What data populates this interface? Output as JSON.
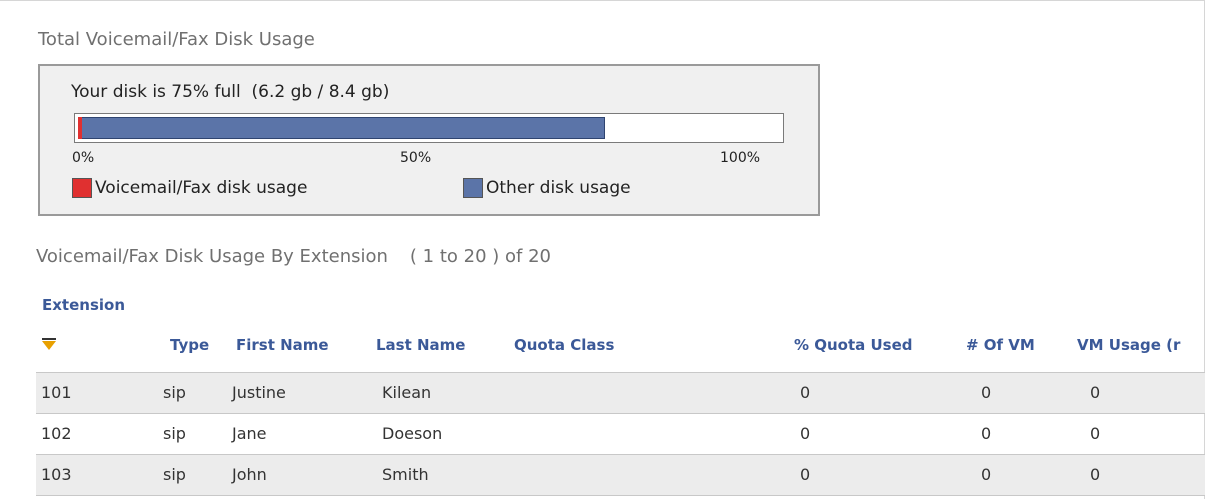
{
  "disk_usage": {
    "title": "Total Voicemail/Fax Disk Usage",
    "summary": "Your disk is 75% full  (6.2 gb / 8.4 gb)",
    "percent_full": 75,
    "voicemail_percent": 1,
    "ticks": [
      "0%",
      "50%",
      "100%"
    ],
    "legend": [
      {
        "label": "Voicemail/Fax disk usage",
        "color": "#e03030"
      },
      {
        "label": "Other disk usage",
        "color": "#5b74a8"
      }
    ]
  },
  "extensions": {
    "title": "Voicemail/Fax Disk Usage By Extension",
    "range": "( 1 to 20 ) of 20",
    "columns": {
      "extension": "Extension",
      "type": "Type",
      "first_name": "First Name",
      "last_name": "Last Name",
      "quota_class": "Quota Class",
      "quota_used": "% Quota Used",
      "vm_count": "# Of VM",
      "vm_usage": "VM Usage (r"
    },
    "sort_icon": "sort-descending-icon",
    "rows": [
      {
        "extension": "101",
        "type": "sip",
        "first_name": "Justine",
        "last_name": "Kilean",
        "quota_class": "",
        "quota_used": "0",
        "vm_count": "0",
        "vm_usage": "0"
      },
      {
        "extension": "102",
        "type": "sip",
        "first_name": "Jane",
        "last_name": "Doeson",
        "quota_class": "",
        "quota_used": "0",
        "vm_count": "0",
        "vm_usage": "0"
      },
      {
        "extension": "103",
        "type": "sip",
        "first_name": "John",
        "last_name": "Smith",
        "quota_class": "",
        "quota_used": "0",
        "vm_count": "0",
        "vm_usage": "0"
      }
    ]
  }
}
